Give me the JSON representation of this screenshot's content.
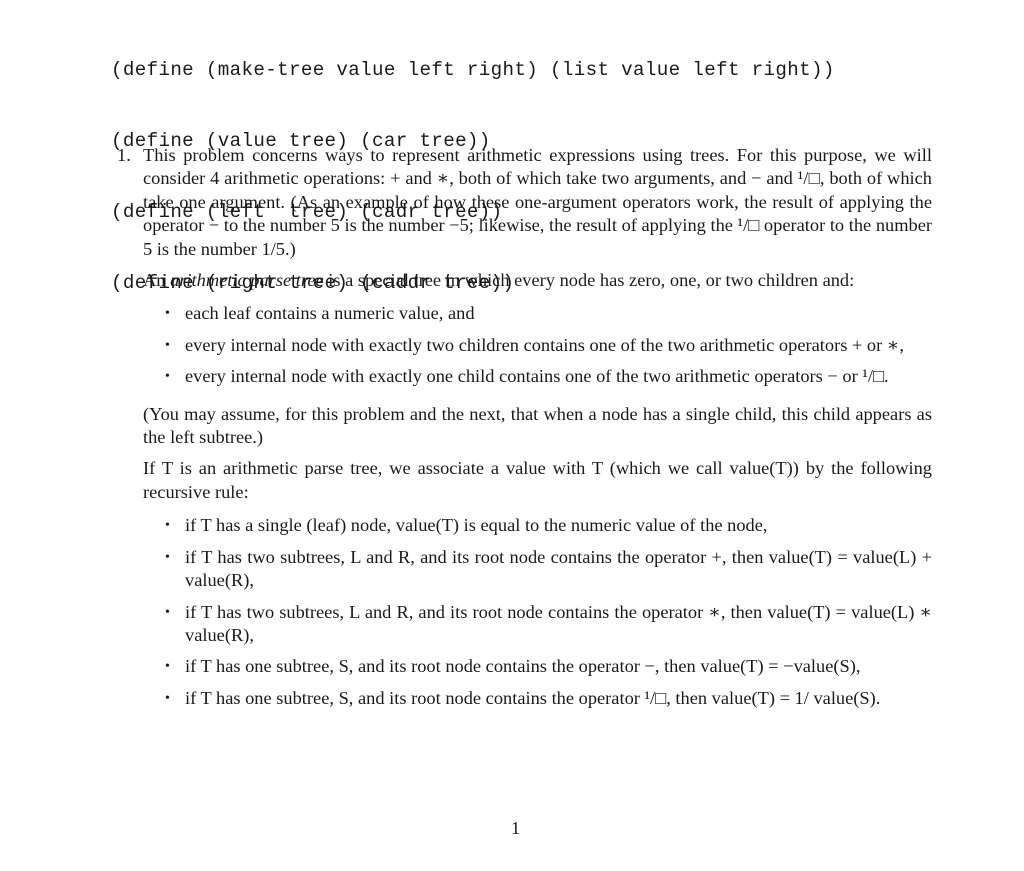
{
  "code_lines": [
    "(define (make-tree value left right) (list value left right))",
    "(define (value tree) (car tree))",
    "(define (left  tree) (cadr tree))",
    "(define (right tree) (caddr tree))"
  ],
  "problem": {
    "number": "1.",
    "intro": "This problem concerns ways to represent arithmetic expressions using trees. For this purpose, we will consider 4 arithmetic operations: + and ∗, both of which take two arguments, and − and ¹/□, both of which take one argument. (As an example of how these one-argument operators work, the result of applying the operator − to the number 5 is the number −5; likewise, the result of applying the ¹/□ operator to the number 5 is the number 1/5.)",
    "definition": {
      "prefix": "An ",
      "term": "arithmetic parse tree",
      "suffix": " is a special tree in which every node has zero, one, or two children and:"
    },
    "conditions": [
      "each leaf contains a numeric value, and",
      "every internal node with exactly two children contains one of the two arithmetic operators + or ∗,",
      "every internal node with exactly one child contains one of the two arithmetic operators − or ¹/□."
    ],
    "assumption": "(You may assume, for this problem and the next, that when a node has a single child, this child appears as the left subtree.)",
    "value_intro": "If T is an arithmetic parse tree, we associate a value with T (which we call value(T)) by the following recursive rule:",
    "rules": [
      "if T has a single (leaf) node, value(T) is equal to the numeric value of the node,",
      "if T has two subtrees, L and R, and its root node contains the operator +, then value(T) = value(L) + value(R),",
      "if T has two subtrees, L and R, and its root node contains the operator ∗, then value(T) = value(L) ∗ value(R),",
      "if T has one subtree, S, and its root node contains the operator −, then value(T) = −value(S),",
      "if T has one subtree, S, and its root node contains the operator ¹/□, then value(T) = 1/ value(S)."
    ]
  },
  "page_number": "1"
}
